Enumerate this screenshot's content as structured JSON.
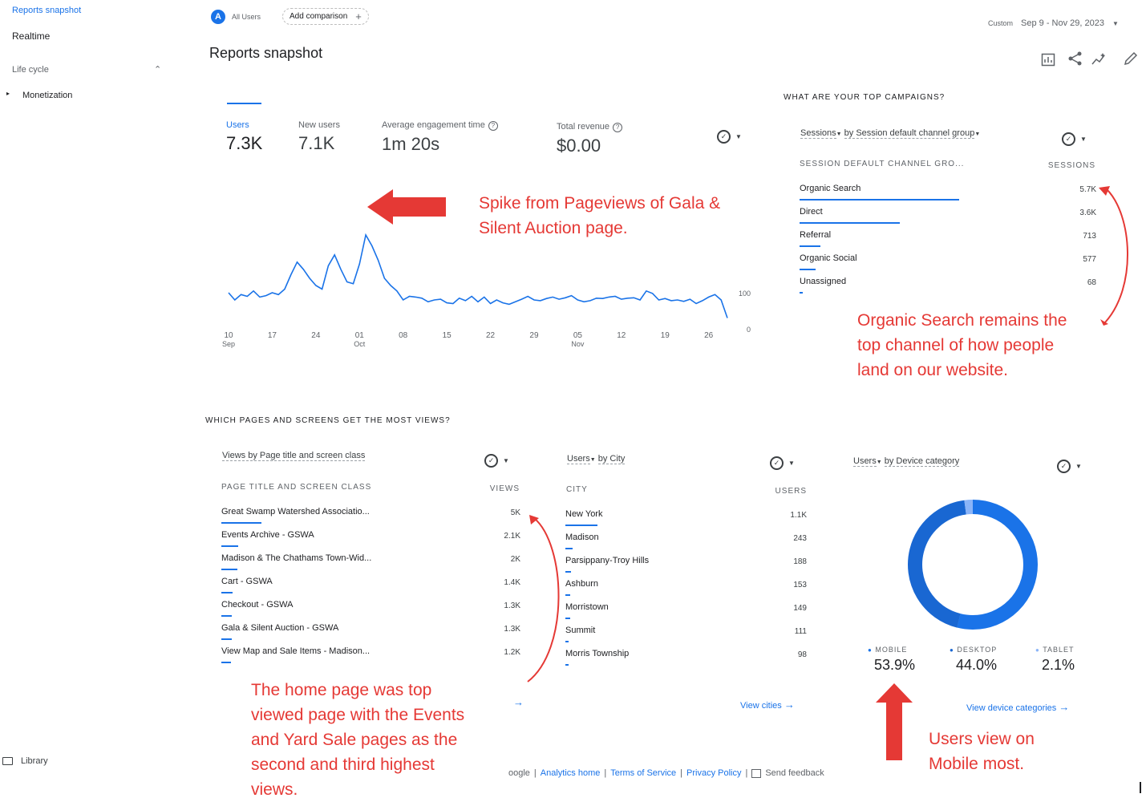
{
  "sidebar": {
    "items": [
      {
        "label": "Reports snapshot"
      },
      {
        "label": "Realtime"
      },
      {
        "label": "Life cycle"
      },
      {
        "label": "Monetization"
      }
    ],
    "library": "Library"
  },
  "header": {
    "all_users": "All Users",
    "add_comparison": "Add comparison",
    "date_prefix": "Custom",
    "date_range": "Sep 9 - Nov 29, 2023",
    "page_title": "Reports snapshot"
  },
  "metrics": [
    {
      "label": "Users",
      "value": "7.3K"
    },
    {
      "label": "New users",
      "value": "7.1K"
    },
    {
      "label": "Average engagement time",
      "value": "1m 20s"
    },
    {
      "label": "Total revenue",
      "value": "$0.00"
    }
  ],
  "chart_data": {
    "type": "line",
    "x": [
      "10 Sep",
      "11 Sep",
      "12 Sep",
      "13 Sep",
      "14 Sep",
      "15 Sep",
      "16 Sep",
      "17 Sep",
      "18 Sep",
      "19 Sep",
      "20 Sep",
      "21 Sep",
      "22 Sep",
      "23 Sep",
      "24 Sep",
      "25 Sep",
      "26 Sep",
      "27 Sep",
      "28 Sep",
      "29 Sep",
      "30 Sep",
      "01 Oct",
      "02 Oct",
      "03 Oct",
      "04 Oct",
      "05 Oct",
      "06 Oct",
      "07 Oct",
      "08 Oct",
      "09 Oct",
      "10 Oct",
      "11 Oct",
      "12 Oct",
      "13 Oct",
      "14 Oct",
      "15 Oct",
      "16 Oct",
      "17 Oct",
      "18 Oct",
      "19 Oct",
      "20 Oct",
      "21 Oct",
      "22 Oct",
      "23 Oct",
      "24 Oct",
      "25 Oct",
      "26 Oct",
      "27 Oct",
      "28 Oct",
      "29 Oct",
      "30 Oct",
      "31 Oct",
      "01 Nov",
      "02 Nov",
      "03 Nov",
      "04 Nov",
      "05 Nov",
      "06 Nov",
      "07 Nov",
      "08 Nov",
      "09 Nov",
      "10 Nov",
      "11 Nov",
      "12 Nov",
      "13 Nov",
      "14 Nov",
      "15 Nov",
      "16 Nov",
      "17 Nov",
      "18 Nov",
      "19 Nov",
      "20 Nov",
      "21 Nov",
      "22 Nov",
      "23 Nov",
      "24 Nov",
      "25 Nov",
      "26 Nov",
      "27 Nov",
      "28 Nov",
      "29 Nov"
    ],
    "values": [
      100,
      80,
      95,
      90,
      105,
      88,
      92,
      100,
      95,
      110,
      150,
      185,
      165,
      140,
      120,
      110,
      175,
      205,
      165,
      130,
      125,
      180,
      260,
      230,
      190,
      140,
      120,
      105,
      80,
      90,
      88,
      85,
      75,
      80,
      82,
      72,
      70,
      85,
      78,
      90,
      75,
      88,
      70,
      80,
      72,
      68,
      75,
      82,
      90,
      80,
      78,
      84,
      88,
      82,
      86,
      92,
      80,
      75,
      78,
      85,
      84,
      88,
      90,
      82,
      85,
      86,
      80,
      105,
      98,
      80,
      84,
      78,
      80,
      76,
      82,
      70,
      78,
      88,
      95,
      80,
      30
    ],
    "y_ticks": [
      "100",
      "0"
    ],
    "x_ticks": [
      {
        "day": "10",
        "month": "Sep"
      },
      {
        "day": "17",
        "month": ""
      },
      {
        "day": "24",
        "month": ""
      },
      {
        "day": "01",
        "month": "Oct"
      },
      {
        "day": "08",
        "month": ""
      },
      {
        "day": "15",
        "month": ""
      },
      {
        "day": "22",
        "month": ""
      },
      {
        "day": "29",
        "month": ""
      },
      {
        "day": "05",
        "month": "Nov"
      },
      {
        "day": "12",
        "month": ""
      },
      {
        "day": "19",
        "month": ""
      },
      {
        "day": "26",
        "month": ""
      }
    ]
  },
  "campaigns": {
    "section_title": "WHAT ARE YOUR TOP CAMPAIGNS?",
    "card_title_metric": "Sessions",
    "card_title_dim": "by Session default channel group",
    "col_label": "SESSION DEFAULT CHANNEL GRO...",
    "col_value": "SESSIONS",
    "rows": [
      {
        "label": "Organic Search",
        "value": "5.7K",
        "share": 1.0
      },
      {
        "label": "Direct",
        "value": "3.6K",
        "share": 0.63
      },
      {
        "label": "Referral",
        "value": "713",
        "share": 0.13
      },
      {
        "label": "Organic Social",
        "value": "577",
        "share": 0.1
      },
      {
        "label": "Unassigned",
        "value": "68",
        "share": 0.02
      }
    ]
  },
  "pages": {
    "section_title": "WHICH PAGES AND SCREENS GET THE MOST VIEWS?",
    "card_title": "Views by Page title and screen class",
    "col_label": "PAGE TITLE AND SCREEN CLASS",
    "col_value": "VIEWS",
    "rows": [
      {
        "label": "Great Swamp Watershed Associatio...",
        "value": "5K",
        "share": 1.0
      },
      {
        "label": "Events Archive - GSWA",
        "value": "2.1K",
        "share": 0.42
      },
      {
        "label": "Madison & The Chathams Town-Wid...",
        "value": "2K",
        "share": 0.4
      },
      {
        "label": "Cart - GSWA",
        "value": "1.4K",
        "share": 0.28
      },
      {
        "label": "Checkout - GSWA",
        "value": "1.3K",
        "share": 0.26
      },
      {
        "label": "Gala & Silent Auction - GSWA",
        "value": "1.3K",
        "share": 0.26
      },
      {
        "label": "View Map and Sale Items - Madison...",
        "value": "1.2K",
        "share": 0.24
      }
    ]
  },
  "cities": {
    "card_title_metric": "Users",
    "card_title_dim": "by City",
    "col_label": "CITY",
    "col_value": "USERS",
    "rows": [
      {
        "label": "New York",
        "value": "1.1K",
        "share": 1.0
      },
      {
        "label": "Madison",
        "value": "243",
        "share": 0.22
      },
      {
        "label": "Parsippany-Troy Hills",
        "value": "188",
        "share": 0.17
      },
      {
        "label": "Ashburn",
        "value": "153",
        "share": 0.14
      },
      {
        "label": "Morristown",
        "value": "149",
        "share": 0.14
      },
      {
        "label": "Summit",
        "value": "111",
        "share": 0.1
      },
      {
        "label": "Morris Township",
        "value": "98",
        "share": 0.09
      }
    ],
    "link": "View cities"
  },
  "devices": {
    "card_title_metric": "Users",
    "card_title_dim": "by Device category",
    "items": [
      {
        "label": "MOBILE",
        "value": "53.9%",
        "pct": 53.9,
        "color": "#1a73e8"
      },
      {
        "label": "DESKTOP",
        "value": "44.0%",
        "pct": 44.0,
        "color": "#1967d2"
      },
      {
        "label": "TABLET",
        "value": "2.1%",
        "pct": 2.1,
        "color": "#8ab4f8"
      }
    ],
    "link": "View device categories"
  },
  "annotations": {
    "spike": [
      "Spike from Pageviews of Gala &",
      "Silent Auction page."
    ],
    "organic": [
      "Organic Search remains the",
      "top channel of how people",
      "land on our website."
    ],
    "home": [
      "The home page was top",
      "viewed page with the Events",
      "and Yard Sale pages as the",
      "second and third highest",
      "views."
    ],
    "mobile": [
      "Users view on",
      "Mobile most."
    ]
  },
  "footer": {
    "prefix": "oogle",
    "links": [
      "Analytics home",
      "Terms of Service",
      "Privacy Policy"
    ],
    "feedback": "Send feedback"
  },
  "colors": {
    "accent": "#1a73e8",
    "annotation": "#e53935"
  }
}
